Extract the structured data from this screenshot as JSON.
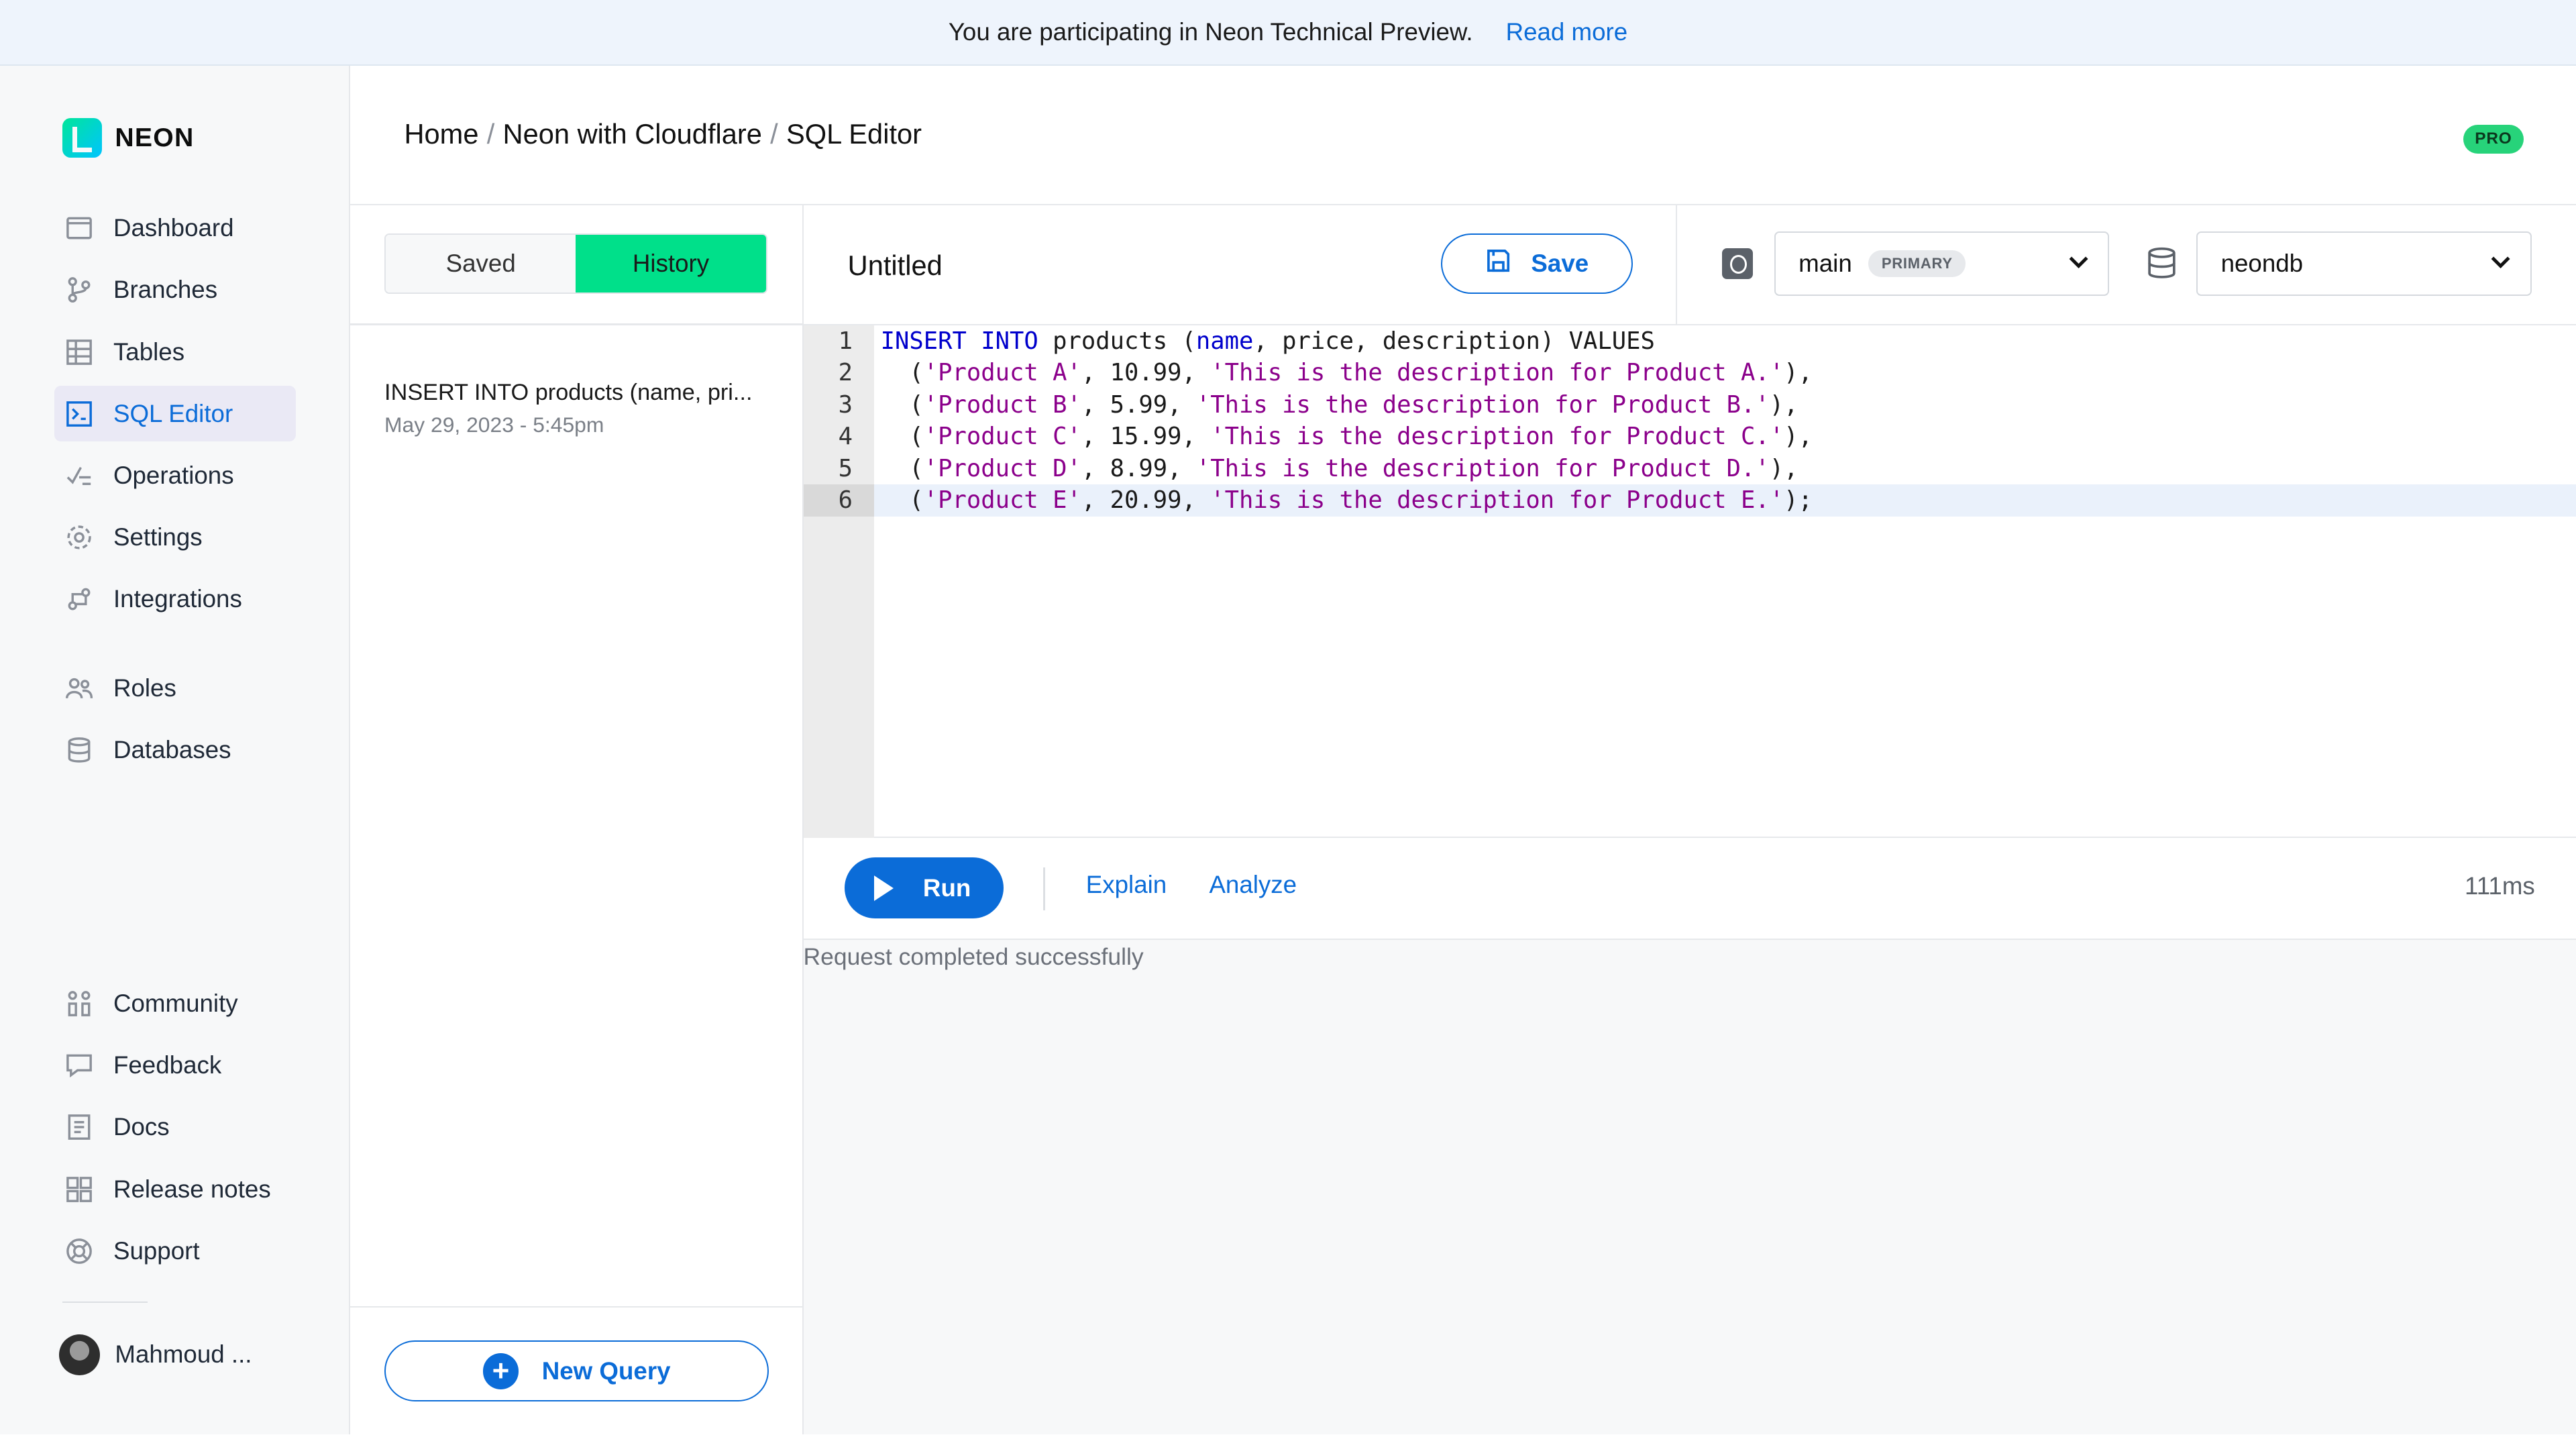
{
  "banner": {
    "text": "You are participating in Neon Technical Preview.",
    "link": "Read more"
  },
  "brand": {
    "name": "NEON"
  },
  "nav": {
    "main": [
      {
        "label": "Dashboard",
        "icon": "dashboard-icon"
      },
      {
        "label": "Branches",
        "icon": "branches-icon"
      },
      {
        "label": "Tables",
        "icon": "tables-icon"
      },
      {
        "label": "SQL Editor",
        "icon": "sql-editor-icon",
        "active": true
      },
      {
        "label": "Operations",
        "icon": "operations-icon"
      },
      {
        "label": "Settings",
        "icon": "settings-icon"
      },
      {
        "label": "Integrations",
        "icon": "integrations-icon"
      }
    ],
    "secondary": [
      {
        "label": "Roles",
        "icon": "roles-icon"
      },
      {
        "label": "Databases",
        "icon": "databases-icon"
      }
    ],
    "footer": [
      {
        "label": "Community",
        "icon": "community-icon"
      },
      {
        "label": "Feedback",
        "icon": "feedback-icon"
      },
      {
        "label": "Docs",
        "icon": "docs-icon"
      },
      {
        "label": "Release notes",
        "icon": "release-notes-icon"
      },
      {
        "label": "Support",
        "icon": "support-icon"
      }
    ]
  },
  "user": {
    "name": "Mahmoud ..."
  },
  "breadcrumb": {
    "home": "Home",
    "project": "Neon with Cloudflare",
    "page": "SQL Editor"
  },
  "plan_badge": "PRO",
  "history_panel": {
    "tab_saved": "Saved",
    "tab_history": "History",
    "items": [
      {
        "query": "INSERT INTO products (name, pri...",
        "date": "May 29, 2023 - 5:45pm"
      }
    ],
    "new_query": "New Query"
  },
  "editor": {
    "title": "Untitled",
    "save": "Save",
    "branch": "main",
    "branch_badge": "PRIMARY",
    "database": "neondb",
    "lines": [
      "INSERT INTO products (name, price, description) VALUES",
      "  ('Product A', 10.99, 'This is the description for Product A.'),",
      "  ('Product B', 5.99, 'This is the description for Product B.'),",
      "  ('Product C', 15.99, 'This is the description for Product C.'),",
      "  ('Product D', 8.99, 'This is the description for Product D.'),",
      "  ('Product E', 20.99, 'This is the description for Product E.');"
    ],
    "current_line": 6
  },
  "toolbar": {
    "run": "Run",
    "explain": "Explain",
    "analyze": "Analyze",
    "timing": "111ms"
  },
  "result": {
    "message": "Request completed successfully"
  },
  "colors": {
    "accent": "#0b6cd8",
    "history_tab": "#00e08a",
    "pro_badge": "#27d37a"
  }
}
